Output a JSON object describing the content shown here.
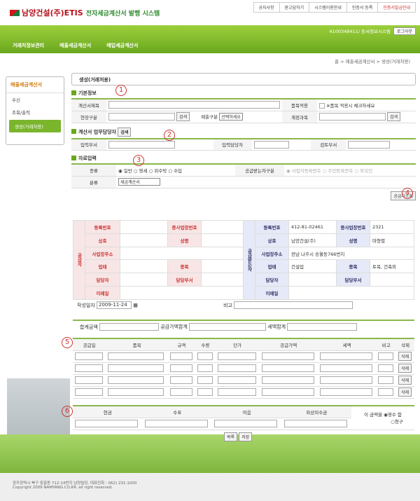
{
  "header": {
    "logo_main": "남양건설(주)ETIS",
    "logo_sub": "전자세금계산서 발행 시스템",
    "links": [
      "공지사항",
      "묻고답하기",
      "시스템이용안내",
      "인증서 등록",
      "인증서발급안내"
    ]
  },
  "user": {
    "text": "4100348411/ 동서정보시스템",
    "logout": "로그아웃"
  },
  "menu": [
    "거래처정보관리",
    "매출세금계산서",
    "매입세금계산서"
  ],
  "breadcrumb": "홈 > 매출세금계산서 > 생성(거래처용)",
  "sidebar": {
    "title": "매출세금계산서",
    "items": [
      "수신",
      "조회/출력",
      "생성(거래처용)"
    ]
  },
  "page_title": "생성(거래처용)",
  "sections": {
    "basic": "기본정보",
    "manager": "계산서 업무담당자",
    "data": "자료입력"
  },
  "basic": {
    "title_lbl": "계산서제목",
    "item_lbl": "품목적용",
    "item_chk": "※품목 적용시 체크하세요",
    "site_lbl": "현장구분",
    "search": "검색",
    "sales_lbl": "매출구분",
    "sales_sel": "선택하세요",
    "acct_lbl": "계정과목"
  },
  "manager": {
    "search": "검색",
    "dept": "입력부서",
    "person": "입력담당자",
    "review": "검토부서"
  },
  "data": {
    "type_lbl": "종류",
    "types": [
      "일반",
      "영세",
      "위수탁",
      "수입"
    ],
    "recv_lbl": "공급받는자구분",
    "recv_types": [
      "사업자등록번호",
      "주민등록번호",
      "외국인"
    ],
    "class_lbl": "분류",
    "class_sel": "세금계산서",
    "lookup": "공급자조회"
  },
  "supplier": {
    "side": "공급자",
    "reg": "등록번호",
    "sub": "종사업장번호",
    "name": "상호",
    "rep": "성명",
    "addr": "사업장주소",
    "biz": "업태",
    "item": "종목",
    "mgr": "담당자",
    "dept": "담당부서",
    "email": "이메일"
  },
  "receiver": {
    "side": "공급받는자",
    "reg_val": "412-81-02461",
    "sub_val": "2321",
    "name_val": "남양건설(주)",
    "rep_val": "마형렬",
    "addr_val": "전남 나주시 송월동766번지",
    "biz_val": "건설업",
    "item_val": "토목, 건축외"
  },
  "date": {
    "lbl": "작성일자",
    "val": "2009-11-24",
    "note": "비고"
  },
  "totals": {
    "sum": "합계금액",
    "supply": "공급가액합계",
    "tax": "세액합계"
  },
  "items_hdr": [
    "공급일",
    "품목",
    "규격",
    "수량",
    "단가",
    "공급가액",
    "세액",
    "비고",
    "삭제"
  ],
  "delete": "삭제",
  "pay_hdr": [
    "현금",
    "수표",
    "어음",
    "외상미수금"
  ],
  "pay": {
    "text": "이 금액을",
    "opt1": "영수",
    "opt2": "청구",
    "suffix": "함"
  },
  "actions": {
    "list": "목록",
    "save": "저장"
  },
  "footer": {
    "addr": "광주광역시 북구 중흥동 712-14번지 남양빌딩, 대표전화 : 062) 231-1000",
    "copy": "Copyright 2009 NAMYANG.CO.KR. all right reserved."
  },
  "markers": [
    "1",
    "2",
    "3",
    "4",
    "5",
    "6"
  ]
}
